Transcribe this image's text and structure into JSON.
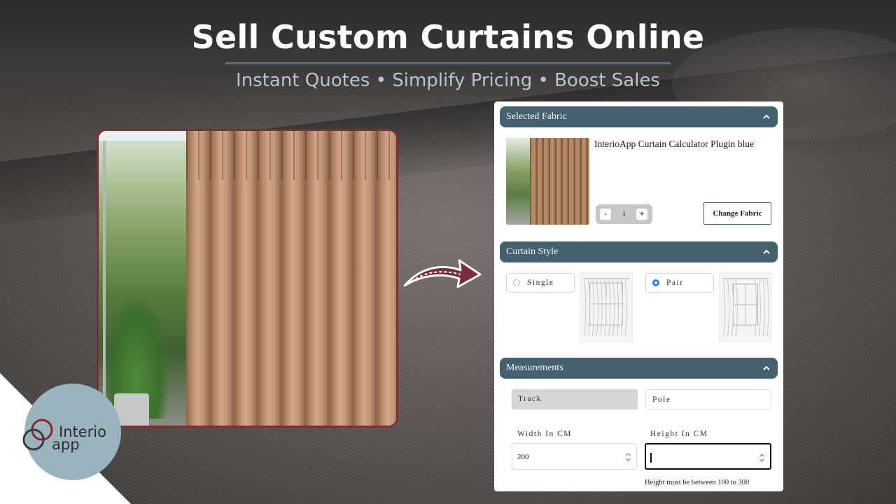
{
  "hero": {
    "title": "Sell Custom Curtains Online",
    "subtitle": "Instant Quotes • Simplify Pricing • Boost Sales"
  },
  "brand": {
    "logo_line1": "Interio",
    "logo_line2": "app",
    "accent_color": "#45606e",
    "logo_ring_color": "#8b2332"
  },
  "panel": {
    "selected_fabric": {
      "header": "Selected Fabric",
      "product_name": "InterioApp Curtain Calculator Plugin blue",
      "qty_minus": "-",
      "qty_value": "1",
      "qty_plus": "+",
      "change_button": "Change Fabric"
    },
    "curtain_style": {
      "header": "Curtain Style",
      "options": [
        {
          "label": "Single",
          "selected": false
        },
        {
          "label": "Pair",
          "selected": true
        }
      ]
    },
    "measurements": {
      "header": "Measurements",
      "mount_options": [
        {
          "label": "Track",
          "selected": true
        },
        {
          "label": "Pole",
          "selected": false
        }
      ],
      "width_label": "Width In CM",
      "width_value": "200",
      "height_label": "Height In CM",
      "height_value": "",
      "height_hint": "Height must be between 100 to 300"
    }
  }
}
